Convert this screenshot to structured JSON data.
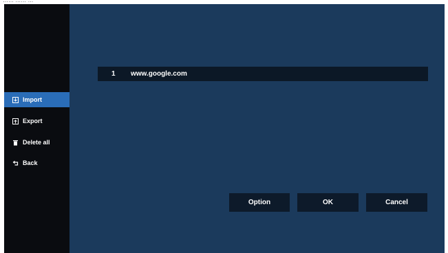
{
  "top_caption": "…… …… …",
  "sidebar": {
    "items": [
      {
        "label": "Import",
        "icon": "import-icon",
        "active": true
      },
      {
        "label": "Export",
        "icon": "export-icon",
        "active": false
      },
      {
        "label": "Delete all",
        "icon": "trash-icon",
        "active": false
      },
      {
        "label": "Back",
        "icon": "back-arrow-icon",
        "active": false
      }
    ]
  },
  "list": {
    "rows": [
      {
        "index": "1",
        "url": "www.google.com"
      }
    ]
  },
  "buttons": {
    "option_label": "Option",
    "ok_label": "OK",
    "cancel_label": "Cancel"
  },
  "colors": {
    "main_background": "#1b3a5c",
    "sidebar_background": "#0a0c10",
    "active_item": "#2a6db8",
    "row_background": "#0c1826",
    "button_background": "#0d1a2a",
    "text": "#ffffff"
  }
}
